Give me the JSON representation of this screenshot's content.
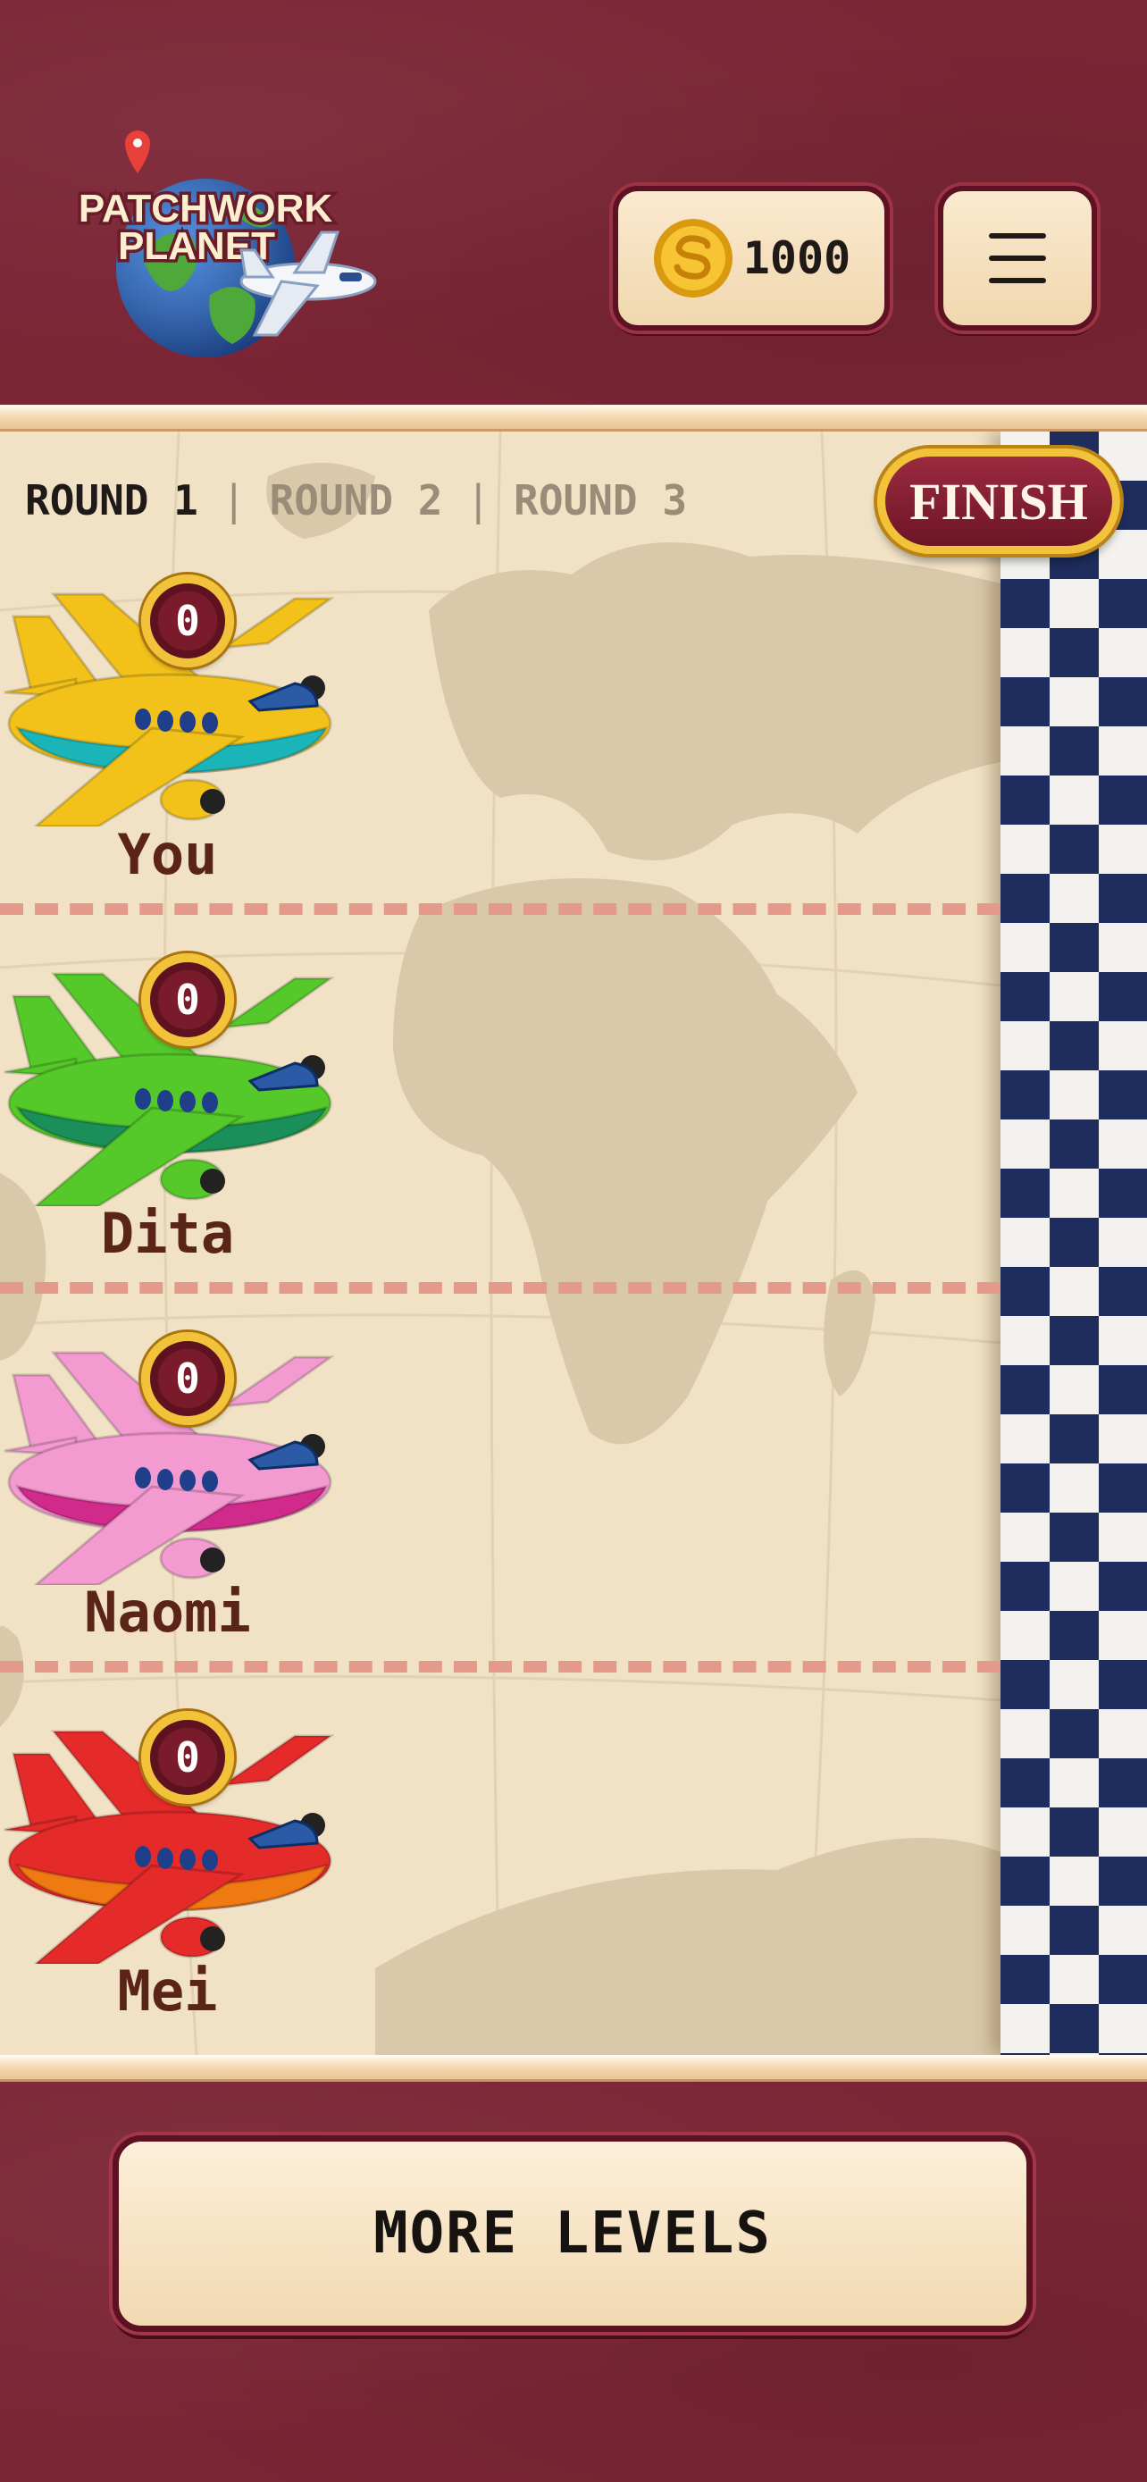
{
  "app": {
    "logo_line1": "PATCHWORK",
    "logo_line2": "PLANET"
  },
  "header": {
    "coins": "1000",
    "coin_icon": "coin-icon",
    "menu_icon": "hamburger-icon"
  },
  "race": {
    "rounds": [
      "ROUND 1",
      "ROUND 2",
      "ROUND 3"
    ],
    "separator": "|",
    "active_round": 0,
    "finish_label": "FINISH",
    "players": [
      {
        "name": "You",
        "score": "0",
        "color": "#f3c21a",
        "accent": "#1bb5b9"
      },
      {
        "name": "Dita",
        "score": "0",
        "color": "#56c92a",
        "accent": "#1a8f5a"
      },
      {
        "name": "Naomi",
        "score": "0",
        "color": "#f39ad1",
        "accent": "#d02a8a"
      },
      {
        "name": "Mei",
        "score": "0",
        "color": "#e52a2a",
        "accent": "#f07a12"
      }
    ]
  },
  "footer": {
    "more_levels_label": "MORE LEVELS"
  },
  "colors": {
    "maroon": "#7b2535",
    "parchment": "#f1e2c6",
    "gold": "#f2c23a",
    "checker_dark": "#1e2d5e",
    "name_text": "#5a2418"
  }
}
